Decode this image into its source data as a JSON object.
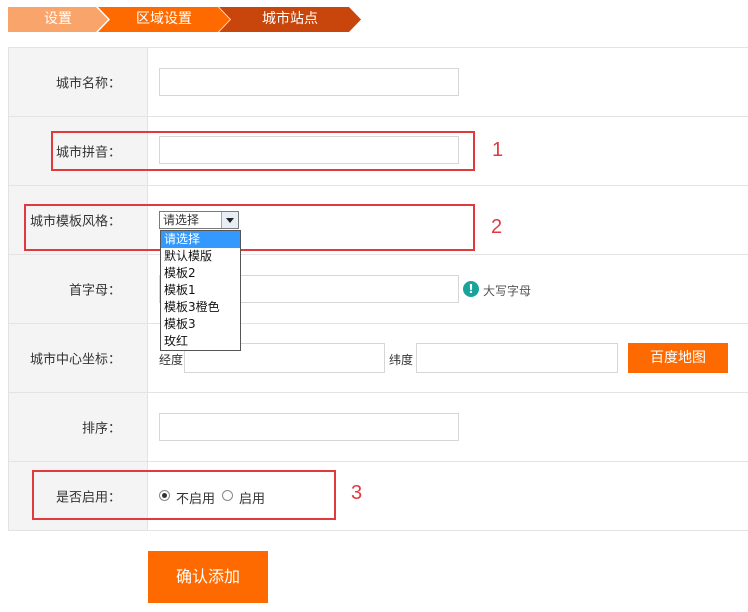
{
  "breadcrumb": [
    "设置",
    "区域设置",
    "城市站点"
  ],
  "form": {
    "city_name_label": "城市名称：",
    "city_pinyin_label": "城市拼音：",
    "template_label": "城市模板风格：",
    "initial_label": "首字母：",
    "center_label": "城市中心坐标：",
    "sort_label": "排序：",
    "enabled_label": "是否启用："
  },
  "template_select": {
    "selected": "请选择",
    "options": [
      "请选择",
      "默认模版",
      "模板2",
      "模板1",
      "模板3橙色",
      "模板3",
      "玫红"
    ]
  },
  "initial_tip": "大写字母",
  "coords": {
    "lng_label": "经度",
    "lat_label": "纬度",
    "map_button": "百度地图"
  },
  "enabled": {
    "off_label": "不启用",
    "on_label": "启用",
    "selected": "不启用"
  },
  "annotations": [
    "1",
    "2",
    "3"
  ],
  "submit_label": "确认添加",
  "colors": {
    "accent": "#ff6a00",
    "annotation": "#e0393e",
    "crumb_light": "#f9a46a",
    "crumb_mid": "#ff6a00",
    "crumb_dark": "#c8460b"
  }
}
